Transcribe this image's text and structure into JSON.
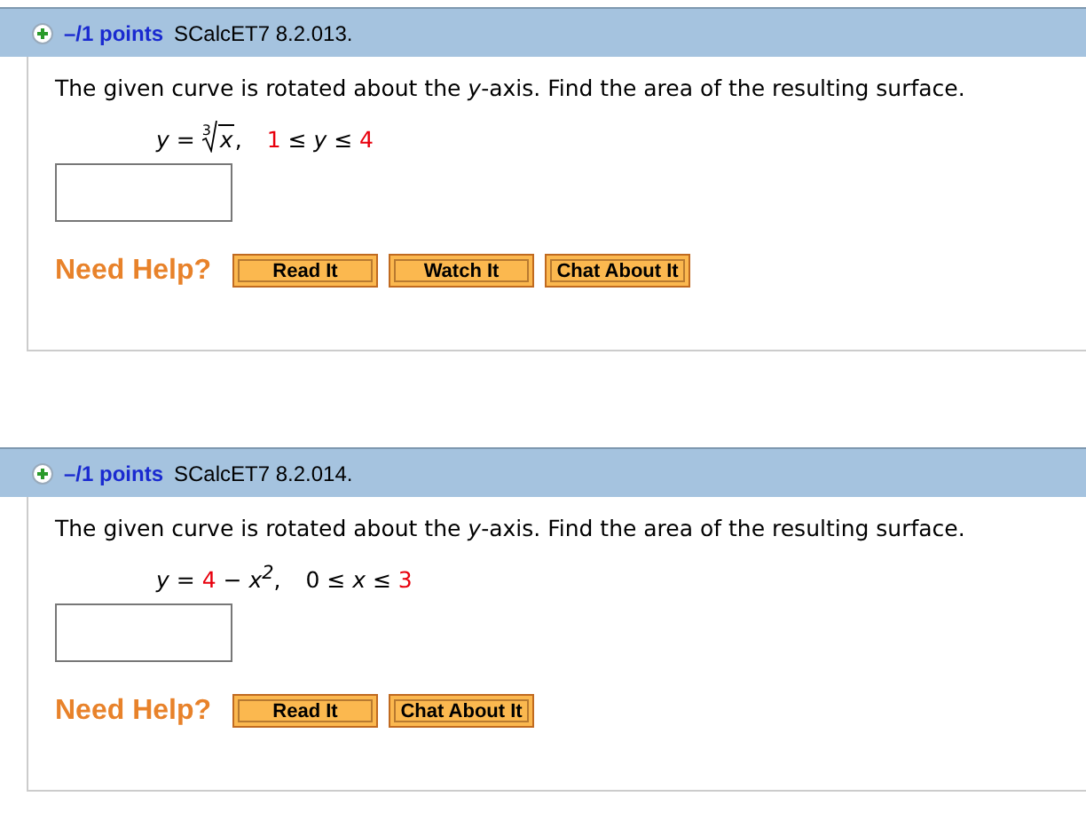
{
  "questions": [
    {
      "points": "–/1 points",
      "code": "SCalcET7 8.2.013.",
      "prompt": "The given curve is rotated about the *y*-axis. Find the area of the resulting surface.",
      "equation": [
        {
          "kind": "italic",
          "text": "y"
        },
        {
          "kind": "plain",
          "text": " = "
        },
        {
          "kind": "root",
          "index": "3",
          "text": "x"
        },
        {
          "kind": "plain",
          "text": ","
        },
        {
          "kind": "gap"
        },
        {
          "kind": "given",
          "text": "1"
        },
        {
          "kind": "plain",
          "text": " ≤ "
        },
        {
          "kind": "italic",
          "text": "y"
        },
        {
          "kind": "plain",
          "text": " ≤ "
        },
        {
          "kind": "given",
          "text": "4"
        }
      ],
      "help_label": "Need Help?",
      "buttons": [
        "Read It",
        "Watch It",
        "Chat About It"
      ]
    },
    {
      "points": "–/1 points",
      "code": "SCalcET7 8.2.014.",
      "prompt": "The given curve is rotated about the *y*-axis. Find the area of the resulting surface.",
      "equation": [
        {
          "kind": "italic",
          "text": "y"
        },
        {
          "kind": "plain",
          "text": " = "
        },
        {
          "kind": "given",
          "text": "4"
        },
        {
          "kind": "plain",
          "text": " − "
        },
        {
          "kind": "italic",
          "text": "x$^{2}$"
        },
        {
          "kind": "plain",
          "text": ","
        },
        {
          "kind": "gap"
        },
        {
          "kind": "plain",
          "text": "0 ≤ "
        },
        {
          "kind": "italic",
          "text": "x"
        },
        {
          "kind": "plain",
          "text": " ≤ "
        },
        {
          "kind": "given",
          "text": "3"
        }
      ],
      "help_label": "Need Help?",
      "buttons": [
        "Read It",
        "Chat About It"
      ]
    }
  ]
}
